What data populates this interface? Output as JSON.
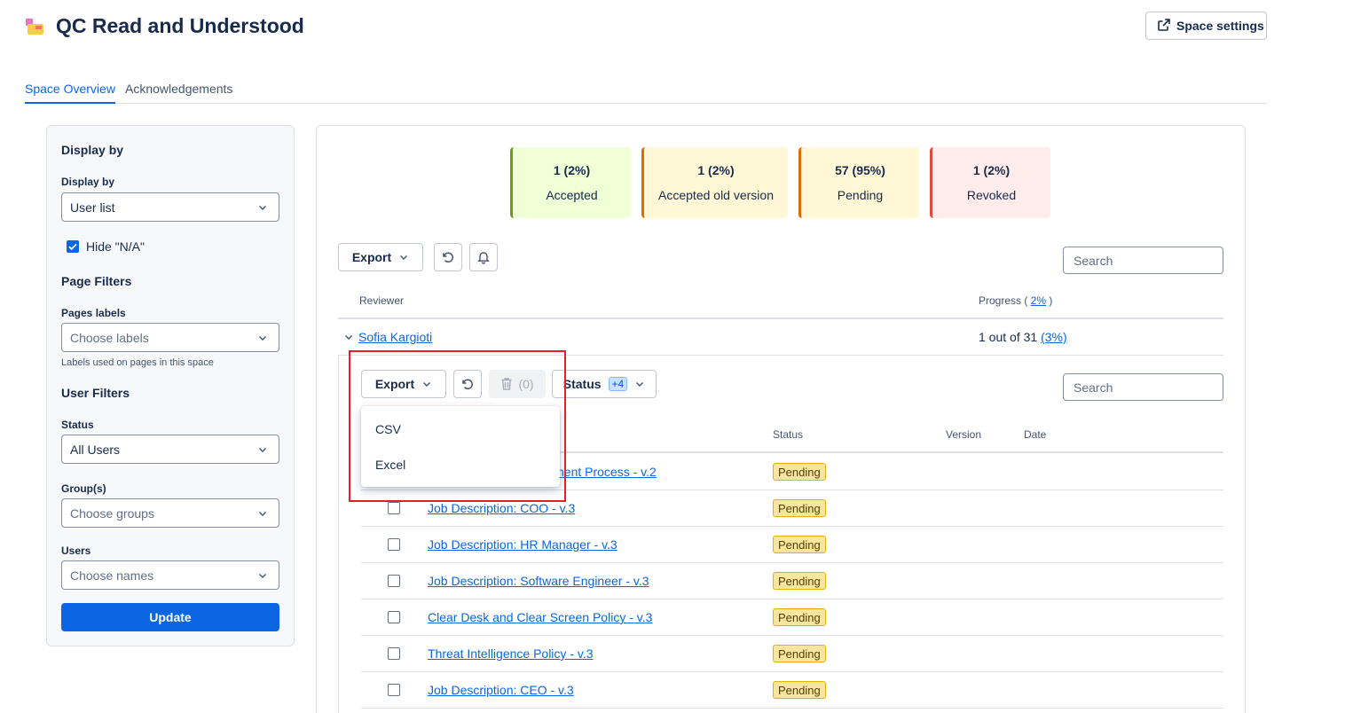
{
  "header": {
    "title": "QC Read and Understood",
    "space_settings_label": "Space settings"
  },
  "tabs": [
    {
      "label": "Space Overview",
      "active": true
    },
    {
      "label": "Acknowledgements",
      "active": false
    }
  ],
  "filters": {
    "display_by_heading": "Display by",
    "display_by_label": "Display by",
    "display_by_value": "User list",
    "hide_na_label": "Hide \"N/A\"",
    "hide_na_checked": true,
    "page_filters_heading": "Page Filters",
    "pages_labels_label": "Pages labels",
    "pages_labels_placeholder": "Choose labels",
    "pages_labels_helper": "Labels used on pages in this space",
    "user_filters_heading": "User Filters",
    "status_label": "Status",
    "status_value": "All Users",
    "groups_label": "Group(s)",
    "groups_placeholder": "Choose groups",
    "users_label": "Users",
    "users_placeholder": "Choose names",
    "update_label": "Update"
  },
  "summary": [
    {
      "value": "1 (2%)",
      "label": "Accepted",
      "bg": "#efffd6",
      "border": "#6a9a23"
    },
    {
      "value": "1 (2%)",
      "label": "Accepted old version",
      "bg": "#fff7d6",
      "border": "#e06c00"
    },
    {
      "value": "57 (95%)",
      "label": "Pending",
      "bg": "#fff7d6",
      "border": "#e06c00"
    },
    {
      "value": "1 (2%)",
      "label": "Revoked",
      "bg": "#ffeceb",
      "border": "#e2483d"
    }
  ],
  "toolbar": {
    "export_label": "Export",
    "search_placeholder": "Search"
  },
  "reviewers_table": {
    "col_reviewer": "Reviewer",
    "col_progress_prefix": "Progress (",
    "col_progress_link": "2%",
    "col_progress_suffix": ")",
    "reviewer": {
      "name": "Sofia Kargioti",
      "progress_text": "1 out of 31",
      "progress_link": "(3%)"
    }
  },
  "sub_toolbar": {
    "export_label": "Export",
    "delete_count": "(0)",
    "status_label": "Status",
    "status_badge": "+4",
    "search_placeholder": "Search"
  },
  "export_menu": {
    "items": [
      "CSV",
      "Excel"
    ]
  },
  "pages_table": {
    "col_status": "Status",
    "col_version": "Version",
    "col_date": "Date",
    "partial_row_link": "nent Process - v.2",
    "rows": [
      {
        "title": "Job Description: COO - v.3",
        "status": "Pending"
      },
      {
        "title": "Job Description: HR Manager - v.3",
        "status": "Pending"
      },
      {
        "title": "Job Description: Software Engineer - v.3",
        "status": "Pending"
      },
      {
        "title": "Clear Desk and Clear Screen Policy - v.3",
        "status": "Pending"
      },
      {
        "title": "Threat Intelligence Policy - v.3",
        "status": "Pending"
      },
      {
        "title": "Job Description: CEO - v.3",
        "status": "Pending"
      }
    ],
    "partial_row_status": "Pending"
  }
}
